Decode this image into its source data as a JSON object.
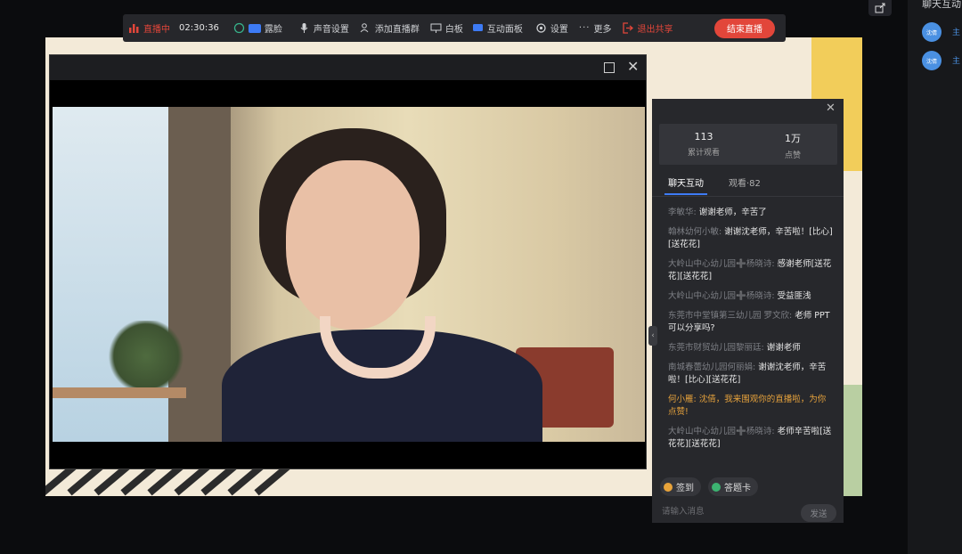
{
  "toolbar": {
    "status": "直播中",
    "timer": "02:30:36",
    "items": [
      {
        "label": "露脸",
        "icon": "camera-icon"
      },
      {
        "label": "声音设置",
        "icon": "microphone-icon"
      },
      {
        "label": "添加直播群",
        "icon": "group-add-icon"
      },
      {
        "label": "白板",
        "icon": "whiteboard-icon"
      },
      {
        "label": "互动面板",
        "icon": "chat-panel-icon"
      },
      {
        "label": "设置",
        "icon": "gear-icon"
      },
      {
        "label": "更多",
        "icon": "more-icon"
      }
    ],
    "exit_share": "退出共享",
    "end_live": "结束直播",
    "colors": {
      "accent_red": "#e2463a",
      "camera_blue": "#3d7bf5",
      "bg": "#26272b"
    }
  },
  "chat": {
    "stats": [
      {
        "value": "113",
        "label": "累计观看"
      },
      {
        "value": "1万",
        "label": "点赞"
      }
    ],
    "tabs": [
      {
        "label": "聊天互动",
        "active": true
      },
      {
        "label": "观看·82",
        "active": false
      }
    ],
    "messages": [
      {
        "user": "李敏华:",
        "text": "谢谢老师，辛苦了"
      },
      {
        "user": "翰林幼何小敏:",
        "text": "谢谢沈老师，辛苦啦！[比心][送花花]"
      },
      {
        "user": "大岭山中心幼儿园➕杨晓诗:",
        "text": "感谢老师[送花花][送花花]"
      },
      {
        "user": "大岭山中心幼儿园➕杨晓诗:",
        "text": "受益匪浅"
      },
      {
        "user": "东莞市中堂镇第三幼儿园 罗文欣:",
        "text": "老师 PPT可以分享吗?"
      },
      {
        "user": "东莞市财贸幼儿园黎丽廷:",
        "text": "谢谢老师"
      },
      {
        "user": "南城春蕾幼儿园何丽娟:",
        "text": "谢谢沈老师，辛苦啦！[比心][送花花]"
      },
      {
        "user": "何小雁:",
        "text": "沈倩，我来围观你的直播啦，为你点赞!",
        "highlight": true
      },
      {
        "user": "大岭山中心幼儿园➕杨晓诗:",
        "text": "老师辛苦啦[送花花][送花花]"
      }
    ],
    "actions": [
      {
        "label": "签到",
        "icon": "checkin-icon",
        "color": "#e8a33a"
      },
      {
        "label": "答题卡",
        "icon": "quiz-card-icon",
        "color": "#3cb371"
      }
    ],
    "input_placeholder": "请输入消息",
    "send_label": "发送"
  },
  "side": {
    "title": "聊天互动",
    "avatars": [
      "沈倩",
      "沈倩"
    ],
    "items": [
      "主",
      "主"
    ]
  }
}
